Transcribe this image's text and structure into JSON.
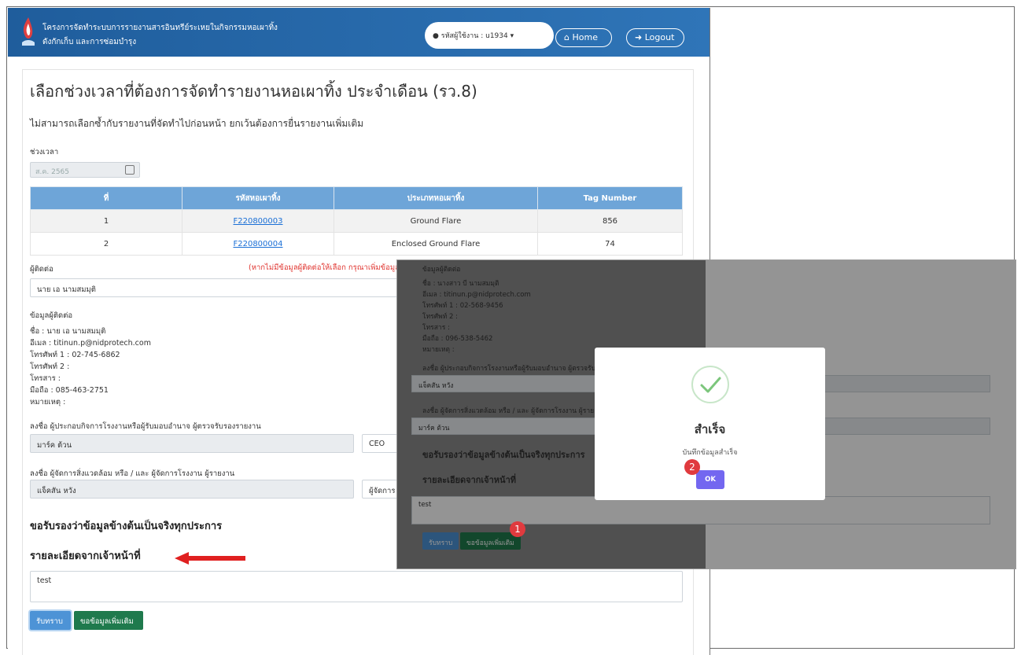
{
  "header": {
    "line1": "โครงการจัดทำระบบการรายงานสารอินทรีย์ระเหยในกิจกรรมหอเผาทิ้ง",
    "line2": "ดังกักเก็บ และการซ่อมบำรุง",
    "user_label": "รหัสผู้ใช้งาน : u1934",
    "home_label": "Home",
    "logout_label": "Logout"
  },
  "page": {
    "title": "เลือกช่วงเวลาที่ต้องการจัดทำรายงานหอเผาทิ้ง ประจำเดือน (รว.8)",
    "subtitle": "ไม่สามารถเลือกซ้ำกับรายงานที่จัดทำไปก่อนหน้า ยกเว้นต้องการยื่นรายงานเพิ่มเติม",
    "period_label": "ช่วงเวลา",
    "period_value": "ส.ค. 2565"
  },
  "table": {
    "headers": [
      "ที่",
      "รหัสหอเผาทิ้ง",
      "ประเภทหอเผาทิ้ง",
      "Tag Number"
    ],
    "rows": [
      [
        "1",
        "F220800003",
        "Ground Flare",
        "856"
      ],
      [
        "2",
        "F220800004",
        "Enclosed Ground Flare",
        "74"
      ]
    ]
  },
  "contact": {
    "label": "ผู้ติดต่อ",
    "note": "(หากไม่มีข้อมูลผู้ติดต่อให้เลือก กรุณาเพิ่มข้อมูลผู้ติดต่อในหน้าเพิ่มข้อมูลผู้ติดต่อ)",
    "selected": "นาย เอ นามสมมุติ",
    "info_heading": "ข้อมูลผู้ติดต่อ",
    "name": "ชื่อ : นาย เอ นามสมมุติ",
    "email": "อีเมล : titinun.p@nidprotech.com",
    "phone1": "โทรศัพท์ 1 : 02-745-6862",
    "phone2": "โทรศัพท์ 2 :",
    "fax": "โทรสาร :",
    "mobile": "มือถือ : 085-463-2751",
    "remark": "หมายเหตุ :"
  },
  "sign": {
    "op_label": "ลงชื่อ ผู้ประกอบกิจการโรงงานหรือผู้รับมอบอำนาจ ผู้ตรวจรับรองรายงาน",
    "op_name": "มาร์ค ต้วน",
    "op_position": "CEO",
    "env_label": "ลงชื่อ ผู้จัดการสิ่งแวดล้อม หรือ / และ ผู้จัดการโรงงาน ผู้รายงาน",
    "env_name": "แจ็คสัน หวัง",
    "env_position": "ผู้จัดการ"
  },
  "certify": "ขอรับรองว่าข้อมูลข้างต้นเป็นจริงทุกประการ",
  "officer_heading": "รายละเอียดจากเจ้าหน้าที่",
  "officer_text": "test",
  "buttons": {
    "ack": "รับทราบ",
    "request_more": "ขอข้อมูลเพิ่มเติม"
  },
  "overlay": {
    "info_heading": "ข้อมูลผู้ติดต่อ",
    "name": "ชื่อ : นางสาว บี นามสมมุติ",
    "email": "อีเมล : titinun.p@nidprotech.com",
    "phone1": "โทรศัพท์ 1 : 02-568-9456",
    "phone2": "โทรศัพท์ 2 :",
    "fax": "โทรสาร :",
    "mobile": "มือถือ : 096-538-5462",
    "remark": "หมายเหตุ :",
    "op_label": "ลงชื่อ ผู้ประกอบกิจการโรงงานหรือผู้รับมอบอำนาจ ผู้ตรวจรับ",
    "op_name": "แจ็คสัน หวัง",
    "env_label": "ลงชื่อ ผู้จัดการสิ่งแวดล้อม หรือ / และ ผู้จัดการโรงงาน ผู้ราย",
    "env_name": "มาร์ค ต้วน",
    "certify": "ขอรับรองว่าข้อมูลข้างต้นเป็นจริงทุกประการ",
    "officer_heading": "รายละเอียดจากเจ้าหน้าที่",
    "officer_text": "test",
    "ack": "รับทราบ",
    "request_more": "ขอข้อมูลเพิ่มเติม"
  },
  "modal": {
    "title": "สำเร็จ",
    "message": "บันทึกข้อมูลสำเร็จ",
    "ok": "OK"
  },
  "badges": {
    "step1": "1",
    "step2": "2"
  },
  "colors": {
    "header_blue": "#1f5d9c",
    "table_header": "#6ea5d8",
    "green_button": "#1f7a4d",
    "ok_purple": "#7367f0",
    "badge_red": "#e03a3e",
    "arrow_red": "#e02020"
  }
}
